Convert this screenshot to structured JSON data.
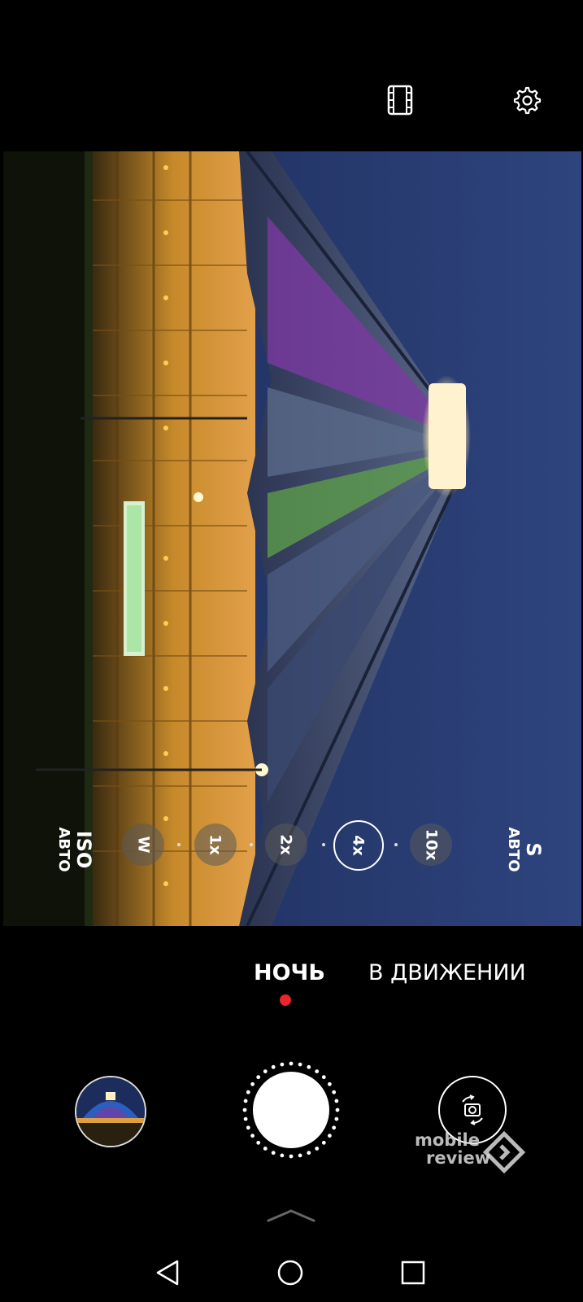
{
  "top_bar": {
    "icons": [
      "film-icon",
      "gear-icon"
    ]
  },
  "viewfinder": {
    "iso_label": "ISO",
    "iso_value": "АВТО",
    "shutter_label": "S",
    "shutter_value": "АВТО",
    "zoom_levels": [
      "W",
      "1x",
      "2x",
      "4x",
      "10x"
    ],
    "active_zoom": "4x"
  },
  "modes": {
    "items": [
      "НОЧЬ",
      "В ДВИЖЕНИИ"
    ],
    "active": "НОЧЬ",
    "indicator_color": "#e8262b"
  },
  "bottom_controls": {
    "icons": [
      "gallery-thumbnail",
      "shutter-button",
      "camera-flip-icon"
    ]
  },
  "watermark": {
    "line1": "mobile",
    "line2": "review"
  },
  "nav_bar": {
    "icons": [
      "back-icon",
      "home-icon",
      "recents-icon",
      "chevron-up-icon"
    ]
  }
}
